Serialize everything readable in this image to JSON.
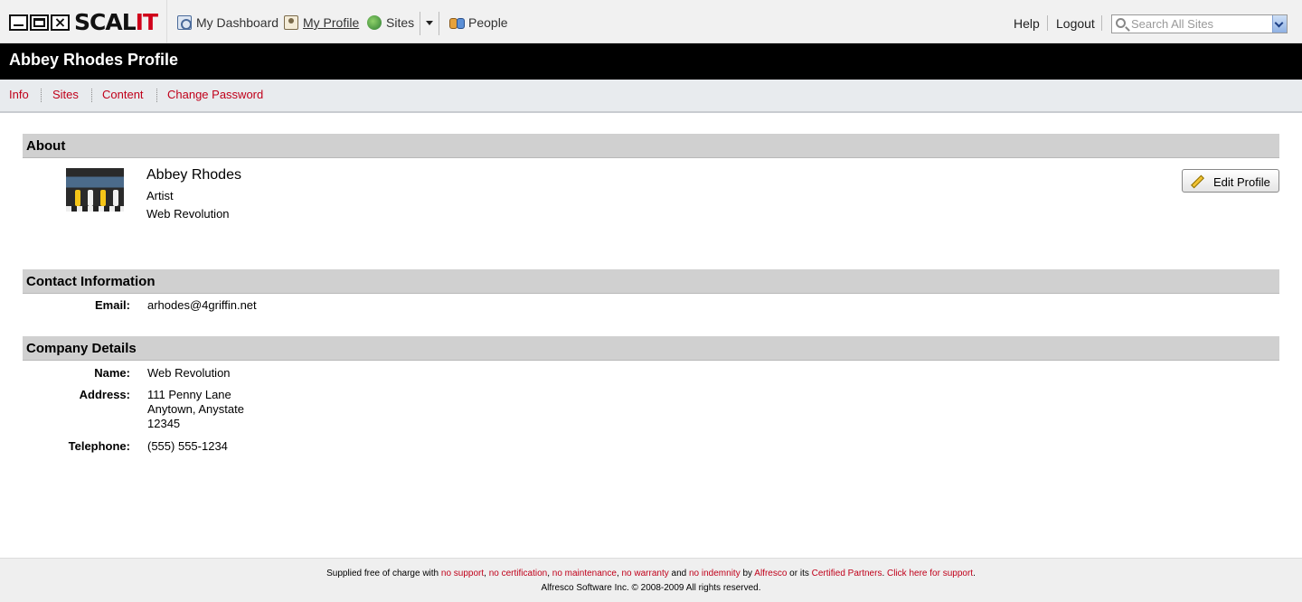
{
  "header": {
    "brand": "SCAL",
    "brand_accent": "IT",
    "nav": {
      "dashboard": "My Dashboard",
      "profile": "My Profile",
      "sites": "Sites",
      "people": "People"
    },
    "help": "Help",
    "logout": "Logout",
    "search_placeholder": "Search All Sites"
  },
  "page": {
    "title": "Abbey Rhodes Profile"
  },
  "subnav": {
    "info": "Info",
    "sites": "Sites",
    "content": "Content",
    "change_password": "Change Password"
  },
  "about": {
    "heading": "About",
    "name": "Abbey Rhodes",
    "job_title": "Artist",
    "organization": "Web Revolution",
    "edit_button": "Edit Profile"
  },
  "contact": {
    "heading": "Contact Information",
    "email_label": "Email:",
    "email": "arhodes@4griffin.net"
  },
  "company": {
    "heading": "Company Details",
    "name_label": "Name:",
    "name": "Web Revolution",
    "address_label": "Address:",
    "address_line1": "111 Penny Lane",
    "address_line2": "Anytown, Anystate",
    "address_line3": "12345",
    "telephone_label": "Telephone:",
    "telephone": "(555) 555-1234"
  },
  "footer": {
    "t1": "Supplied free of charge with ",
    "no_support": "no support",
    "c1": ", ",
    "no_certification": "no certification",
    "c2": ", ",
    "no_maintenance": "no maintenance",
    "c3": ", ",
    "no_warranty": "no warranty",
    "t2": " and ",
    "no_indemnity": "no indemnity",
    "t3": " by ",
    "alfresco": "Alfresco",
    "t4": " or its ",
    "certified_partners": "Certified Partners",
    "t5": ". ",
    "click_support": "Click here for support",
    "t6": ".",
    "copyright": "Alfresco Software Inc. © 2008-2009 All rights reserved."
  },
  "colors": {
    "accent_red": "#c0001a",
    "title_bar": "#000000",
    "section_header": "#d0d0d0"
  }
}
